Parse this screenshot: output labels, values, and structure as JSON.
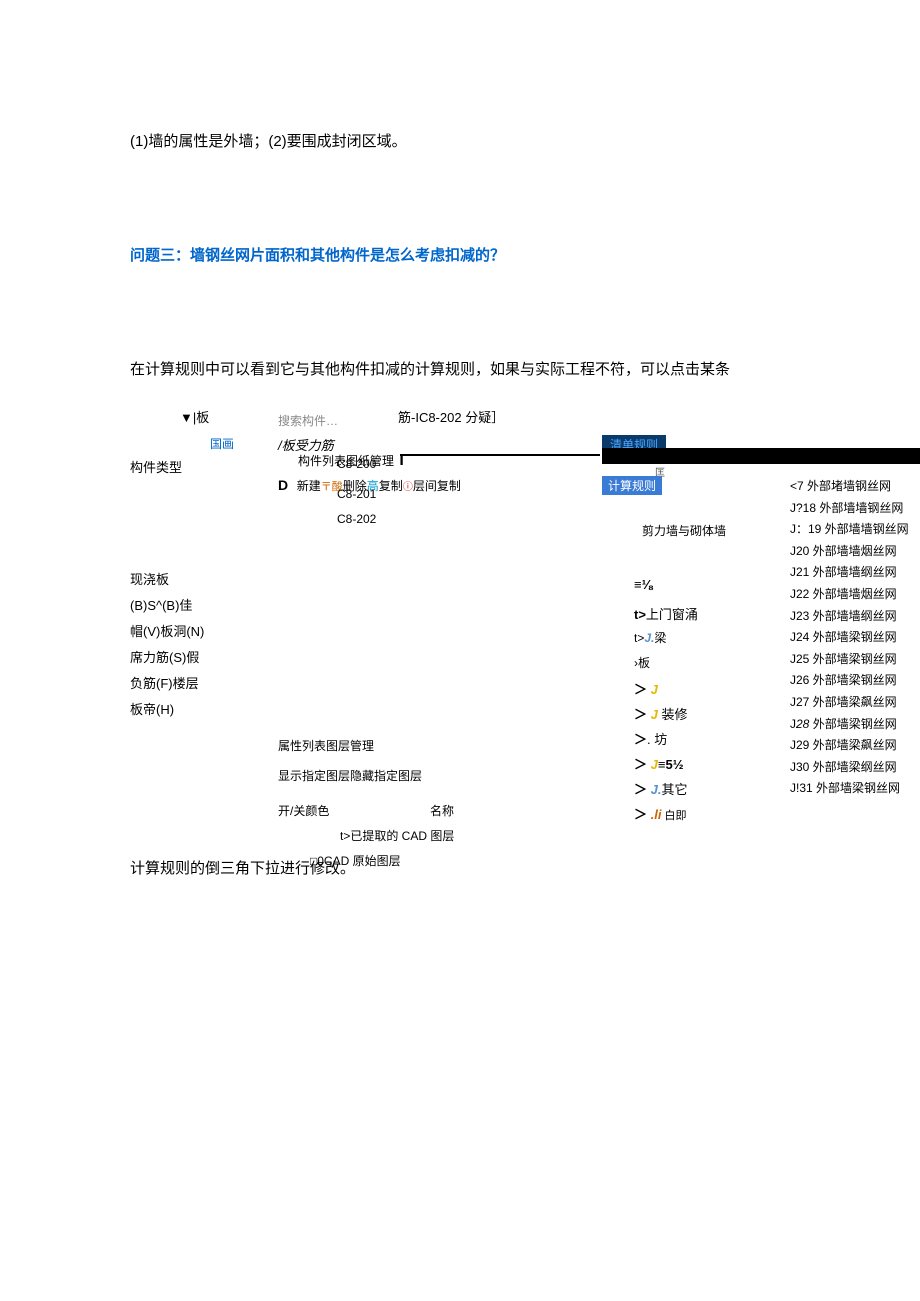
{
  "intro_line": "(1)墙的属性是外墙；(2)要围成封闭区域。",
  "question3": "问题三：墙钢丝网片面积和其他构件是怎么考虑扣减的？",
  "rule_intro": "在计算规则中可以看到它与其他构件扣减的计算规则，如果与实际工程不符，可以点击某条",
  "app": {
    "tri_board": "▼|板",
    "search_placeholder": "搜索构件…",
    "top_right": "筋-IC8-202 分疑］",
    "guohua": "国画",
    "shouli": "/板受力筋",
    "comp_type": "构件类型",
    "comp_list_line": "构件列表图纸管理",
    "big_i": "I",
    "c200": "C8-200",
    "d_letter": "D",
    "new_btn": "新建",
    "suan_char": "〒酸",
    "delete_txt": "删除",
    "gao_txt": "高",
    "copy_txt": "复制",
    "circ_char": "ⓘ",
    "layer_copy": "层间复制",
    "c201": "C8-201",
    "c202": "C8-202",
    "left_terms": {
      "a": "现浇板",
      "b": "(B)S^(B)佳",
      "c": "帽(V)板洞(N)",
      "d": "席力筋(S)假",
      "e": "负筋(F)楼层",
      "f": "板帝(H)"
    },
    "attr_row": "属性列表图层管理",
    "show_row": "显示指定图层隐藏指定图层",
    "color_label": "开/关颜色",
    "name_label": "名称",
    "cad_extracted": "t>已提取的 CAD 图层",
    "cad_original": "□0CAD 原始图层",
    "final_line": "计算规则的倒三角下拉进行修改。"
  },
  "right": {
    "blue_tab": "清单规则",
    "tiny_lbl": "匡",
    "calcrule": "计算规则",
    "shear_wall": "剪力墙与砌体墙",
    "syms": {
      "a": "≡⅛",
      "b_pre": "t>",
      "b_txt": "上门窗涌",
      "c_pre": "t>",
      "c_j": "J.",
      "c_txt": "梁",
      "d_pre": "›",
      "d_txt": "板",
      "e_pre": "＞",
      "e_j": "J",
      "f_pre": "＞",
      "f_j": "J",
      "f_txt": " 装修",
      "g_pre": "＞",
      "g_txt": ". 坊",
      "h_pre": "＞",
      "h_j": "J",
      "h_txt": "≡5½",
      "i_pre": "＞",
      "i_j": "J.",
      "i_txt": "其它",
      "j_pre": "＞",
      "j_li": ".li",
      "j_txt": " 白即"
    },
    "list": {
      "r1": "<7 外部堵墙钢丝网",
      "r2": "J?18 外部墙墙钢丝网",
      "r3": "J：19 外部墙墙钢丝网",
      "r4": "J20 外部墙墙烟丝网",
      "r5": "J21 外部墙墙纲丝网",
      "r6": "J22 外部墙墙烟丝网",
      "r7": "J23 外部墙墙纲丝网",
      "r8": "J24 外部墙梁钢丝网",
      "r9": "J25 外部墙梁钢丝网",
      "r10": "J26 外部墙梁钢丝网",
      "r11": "J27 外部墙梁飙丝网",
      "r12_a": "J",
      "r12_b": "28",
      "r12_c": " 外部墙梁钢丝网",
      "r13": "J29 外部墙梁飙丝网",
      "r14": "J30 外部墙梁纲丝网",
      "r15": "J!31 外部墙梁钢丝网"
    }
  }
}
